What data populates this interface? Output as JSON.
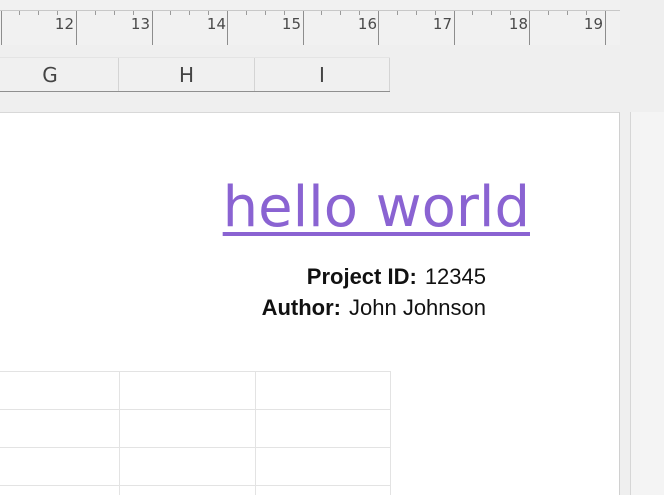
{
  "ruler": {
    "numbers": [
      "12",
      "13",
      "14",
      "15",
      "16",
      "17",
      "18",
      "19"
    ]
  },
  "column_header": {
    "columns": [
      "G",
      "H",
      "I"
    ]
  },
  "document": {
    "title": "hello world",
    "project_id_label": "Project ID:",
    "project_id_value": "12345",
    "author_label": "Author:",
    "author_value": "John Johnson"
  },
  "colors": {
    "title": "#8a63d2",
    "background": "#efefef",
    "page": "#ffffff"
  }
}
